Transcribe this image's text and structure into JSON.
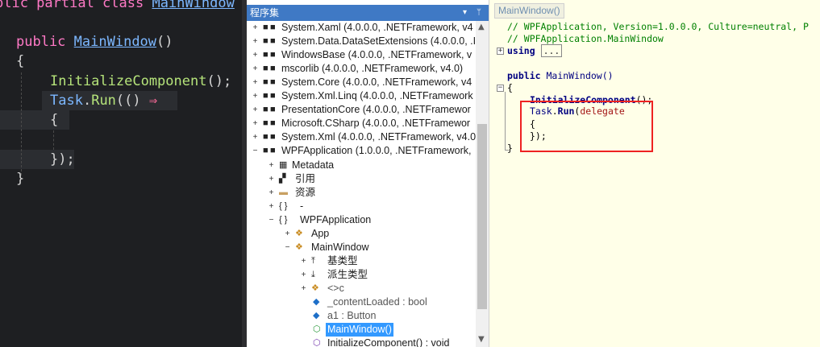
{
  "editor": {
    "line1": {
      "kw": "blic partial class ",
      "cls": "MainWindow"
    },
    "line2": {
      "kw": "public",
      "cls": "MainWindow",
      "tail": "()"
    },
    "line3": "{",
    "line4": {
      "fn": "InitializeComponent",
      "tail": "();"
    },
    "line5": {
      "cls": "Task",
      "dot": ".",
      "fn": "Run",
      "tail": "(() ",
      "arrow": "⇒"
    },
    "line6": "{",
    "line7": "});",
    "line8": "}"
  },
  "assembly": {
    "title": "程序集",
    "dropdown_glyph": "▾",
    "pin_glyph": "ᛘ",
    "items": [
      {
        "label": "System.Xaml (4.0.0.0, .NETFramework, v4"
      },
      {
        "label": "System.Data.DataSetExtensions (4.0.0.0, .I"
      },
      {
        "label": "WindowsBase (4.0.0.0, .NETFramework, v"
      },
      {
        "label": "mscorlib (4.0.0.0, .NETFramework, v4.0)"
      },
      {
        "label": "System.Core (4.0.0.0, .NETFramework, v4"
      },
      {
        "label": "System.Xml.Linq (4.0.0.0, .NETFramework"
      },
      {
        "label": "PresentationCore (4.0.0.0, .NETFramewor"
      },
      {
        "label": "Microsoft.CSharp (4.0.0.0, .NETFramewor"
      },
      {
        "label": "System.Xml (4.0.0.0, .NETFramework, v4.0"
      },
      {
        "label": "WPFApplication (1.0.0.0, .NETFramework,"
      },
      {
        "label": "Metadata"
      },
      {
        "label": "引用"
      },
      {
        "label": "资源"
      },
      {
        "label": "-"
      },
      {
        "label": "WPFApplication"
      },
      {
        "label": "App"
      },
      {
        "label": "MainWindow"
      },
      {
        "label": "基类型"
      },
      {
        "label": "派生类型"
      },
      {
        "label": "<>c"
      },
      {
        "label": "_contentLoaded : bool"
      },
      {
        "label": "a1 : Button"
      },
      {
        "label": "MainWindow()"
      },
      {
        "label": "InitializeComponent() : void"
      }
    ],
    "icons": {
      "assembly": "■",
      "metadata": "▦",
      "references": "▞",
      "folder": "▬",
      "namespace": "{ }",
      "class": "❖",
      "base": "⤒",
      "derived": "⤓",
      "field_blue": "◆",
      "method": "⬡",
      "method_purple": "⬡"
    }
  },
  "decompiled": {
    "tab": "MainWindow()",
    "comment1": "// WPFApplication, Version=1.0.0.0, Culture=neutral, P",
    "comment2": "// WPFApplication.MainWindow",
    "using_kw": "using",
    "using_dots": "...",
    "ctor_kw": "public",
    "ctor_name": "MainWindow",
    "ctor_tail": "()",
    "open_brace": "{",
    "init_call": "InitializeComponent",
    "init_tail": "();",
    "task": "Task",
    "run": "Run",
    "paren": "(",
    "delegate_kw": "delegate",
    "inner_open": "{",
    "inner_close": "});",
    "close_brace": "}"
  }
}
